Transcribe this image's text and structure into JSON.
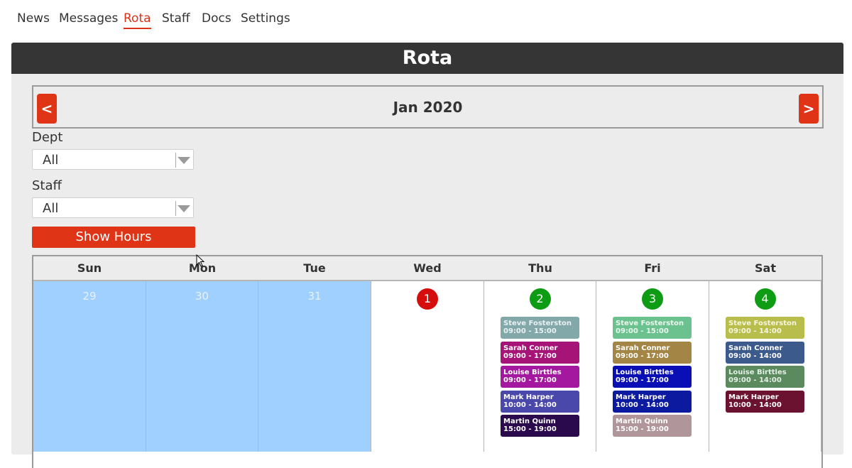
{
  "nav": {
    "items": [
      "News",
      "Messages",
      "Rota",
      "Staff",
      "Docs",
      "Settings"
    ],
    "active": "Rota"
  },
  "page": {
    "title": "Rota"
  },
  "month": {
    "label": "Jan 2020",
    "prev_label": "<",
    "next_label": ">"
  },
  "filters": {
    "dept_label": "Dept",
    "dept_value": "All",
    "staff_label": "Staff",
    "staff_value": "All",
    "show_hours_label": "Show Hours"
  },
  "calendar": {
    "days": [
      "Sun",
      "Mon",
      "Tue",
      "Wed",
      "Thu",
      "Fri",
      "Sat"
    ],
    "cells": [
      {
        "num": "29",
        "in_month": false
      },
      {
        "num": "30",
        "in_month": false
      },
      {
        "num": "31",
        "in_month": false
      },
      {
        "num": "1",
        "in_month": true,
        "badge_color": "#d60d0d",
        "shifts": []
      },
      {
        "num": "2",
        "in_month": true,
        "badge_color": "#0e9c14",
        "shifts": [
          {
            "name": "Steve Fosterston",
            "time": "09:00 - 15:00",
            "bg": "#82a8aa",
            "fg": "#e9f1f1"
          },
          {
            "name": "Sarah Conner",
            "time": "09:00 - 17:00",
            "bg": "#a61478",
            "fg": "#ffffff"
          },
          {
            "name": "Louise Birttles",
            "time": "09:00 - 17:00",
            "bg": "#a4189f",
            "fg": "#ffffff"
          },
          {
            "name": "Mark Harper",
            "time": "10:00 - 14:00",
            "bg": "#4b48ac",
            "fg": "#ffffff"
          },
          {
            "name": "Martin Quinn",
            "time": "15:00 - 19:00",
            "bg": "#2a0a4d",
            "fg": "#ffffff"
          }
        ]
      },
      {
        "num": "3",
        "in_month": true,
        "badge_color": "#0e9c14",
        "shifts": [
          {
            "name": "Steve Fosterston",
            "time": "09:00 - 15:00",
            "bg": "#6cc28f",
            "fg": "#e9f7ee"
          },
          {
            "name": "Sarah Conner",
            "time": "09:00 - 17:00",
            "bg": "#a38546",
            "fg": "#ffffff"
          },
          {
            "name": "Louise Birttles",
            "time": "09:00 - 17:00",
            "bg": "#0a0fb5",
            "fg": "#ffffff"
          },
          {
            "name": "Mark Harper",
            "time": "10:00 - 14:00",
            "bg": "#0c1aa0",
            "fg": "#ffffff"
          },
          {
            "name": "Martin Quinn",
            "time": "15:00 - 19:00",
            "bg": "#b0969a",
            "fg": "#ffffff"
          }
        ]
      },
      {
        "num": "4",
        "in_month": true,
        "badge_color": "#0e9c14",
        "shifts": [
          {
            "name": "Steve Fosterston",
            "time": "09:00 - 14:00",
            "bg": "#b8bd4c",
            "fg": "#f5f6dd"
          },
          {
            "name": "Sarah Conner",
            "time": "09:00 - 14:00",
            "bg": "#3d5a8c",
            "fg": "#ffffff"
          },
          {
            "name": "Louise Birttles",
            "time": "09:00 - 14:00",
            "bg": "#5a8a5e",
            "fg": "#e3eee4"
          },
          {
            "name": "Mark Harper",
            "time": "10:00 - 14:00",
            "bg": "#6c1231",
            "fg": "#ffffff"
          }
        ]
      }
    ]
  },
  "colors": {
    "accent": "#df3416",
    "header_bg": "#353535",
    "prev_month_bg": "#9fd0ff",
    "panel_bg": "#ececec"
  }
}
